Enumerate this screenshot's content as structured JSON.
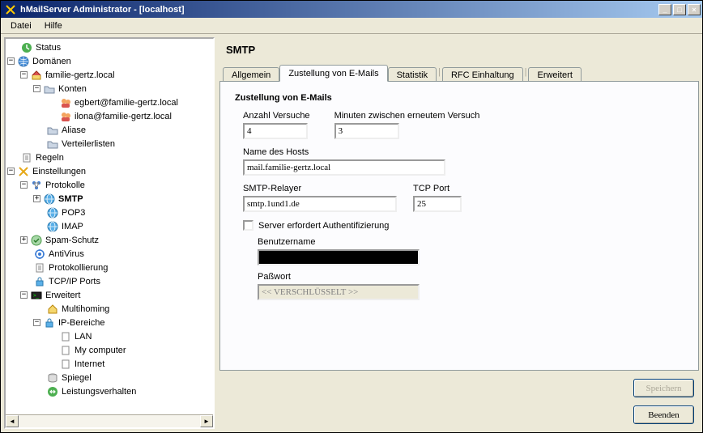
{
  "window": {
    "title": "hMailServer Administrator - [localhost]"
  },
  "menubar": {
    "file": "Datei",
    "help": "Hilfe"
  },
  "tree": {
    "status": "Status",
    "domains": "Domänen",
    "domain_name": "familie-gertz.local",
    "accounts": "Konten",
    "account_egbert": "egbert@familie-gertz.local",
    "account_ilona": "ilona@familie-gertz.local",
    "aliases": "Aliase",
    "dist_lists": "Verteilerlisten",
    "rules": "Regeln",
    "settings": "Einstellungen",
    "protocols": "Protokolle",
    "smtp": "SMTP",
    "pop3": "POP3",
    "imap": "IMAP",
    "spam": "Spam-Schutz",
    "antivirus": "AntiVirus",
    "logging": "Protokollierung",
    "tcpip_ports": "TCP/IP Ports",
    "advanced": "Erweitert",
    "multihoming": "Multihoming",
    "ip_ranges": "IP-Bereiche",
    "lan": "LAN",
    "mycomputer": "My computer",
    "internet": "Internet",
    "mirror": "Spiegel",
    "performance": "Leistungsverhalten"
  },
  "page": {
    "title": "SMTP"
  },
  "tabs": {
    "general": "Allgemein",
    "delivery": "Zustellung von E-Mails",
    "statistics": "Statistik",
    "rfc": "RFC Einhaltung",
    "advanced": "Erweitert"
  },
  "form": {
    "section_title": "Zustellung von E-Mails",
    "retries_label": "Anzahl Versuche",
    "retries_value": "4",
    "minutes_label": "Minuten zwischen erneutem Versuch",
    "minutes_value": "3",
    "hostname_label": "Name des Hosts",
    "hostname_value": "mail.familie-gertz.local",
    "relayer_label": "SMTP-Relayer",
    "relayer_value": "smtp.1und1.de",
    "tcpport_label": "TCP Port",
    "tcpport_value": "25",
    "requires_auth_label": "Server erfordert Authentifizierung",
    "username_label": "Benutzername",
    "username_value": "",
    "password_label": "Paßwort",
    "password_placeholder": "<< VERSCHLÜSSELT >>"
  },
  "buttons": {
    "save": "Speichern",
    "exit": "Beenden"
  }
}
